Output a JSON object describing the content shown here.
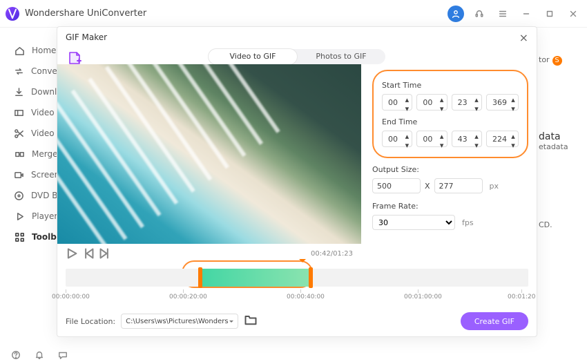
{
  "app_title": "Wondershare UniConverter",
  "window_controls": {
    "minimize": "—",
    "maximize": "▢",
    "close": "×"
  },
  "sidebar": [
    "Home",
    "Converter",
    "Downloader",
    "Video Compressor",
    "Video Editor",
    "Merger",
    "Screen Recorder",
    "DVD Burner",
    "Player",
    "Toolbox"
  ],
  "peek": {
    "tor": "tor",
    "data": "data",
    "etadata": "etadata",
    "cd": "CD."
  },
  "modal": {
    "title": "GIF Maker",
    "tabs": {
      "video": "Video to GIF",
      "photos": "Photos to GIF"
    },
    "time_label_start": "Start Time",
    "time_label_end": "End Time",
    "start": [
      "00",
      "00",
      "23",
      "369"
    ],
    "end": [
      "00",
      "00",
      "43",
      "224"
    ],
    "output_size_label": "Output Size:",
    "output_w": "500",
    "x_sep": "X",
    "output_h": "277",
    "px": "px",
    "frame_rate_label": "Frame Rate:",
    "frame_rate": "30",
    "fps": "fps",
    "player_time": "00:42/01:23",
    "file_loc_label": "File Location:",
    "file_loc_path": "C:\\Users\\ws\\Pictures\\Wonders",
    "create_btn": "Create GIF",
    "ticks": [
      "00:00:00:00",
      "00:00:20:00",
      "00:00:40:00",
      "00:01:00:00",
      "00:01:20"
    ]
  }
}
